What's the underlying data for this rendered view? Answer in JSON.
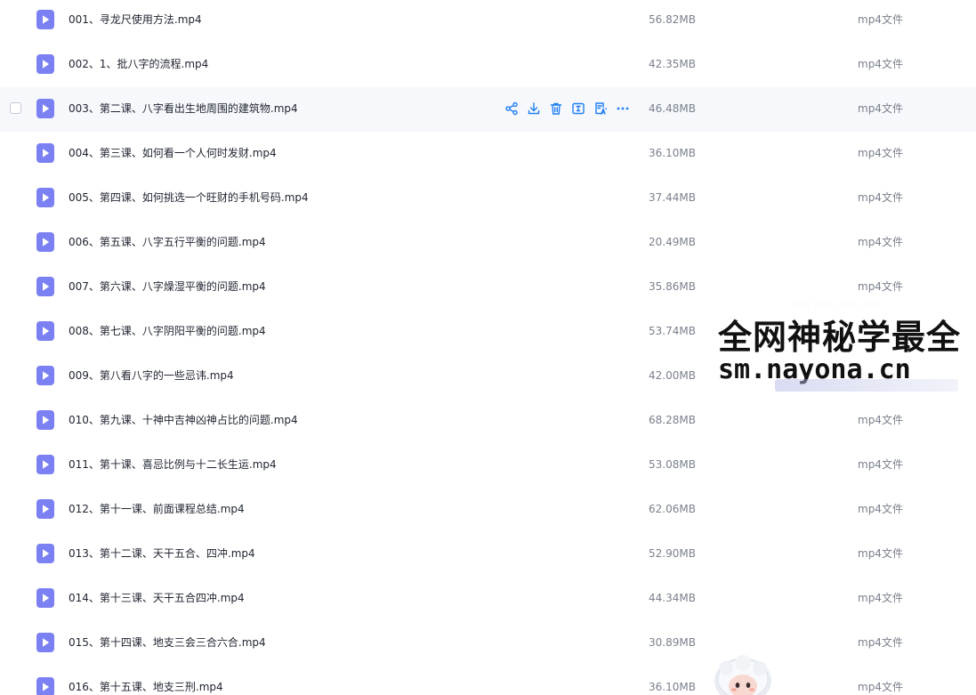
{
  "files": [
    {
      "name": "001、寻龙尺使用方法.mp4",
      "size": "56.82MB",
      "type": "mp4文件"
    },
    {
      "name": "002、1、批八字的流程.mp4",
      "size": "42.35MB",
      "type": "mp4文件"
    },
    {
      "name": "003、第二课、八字看出生地周围的建筑物.mp4",
      "size": "46.48MB",
      "type": "mp4文件"
    },
    {
      "name": "004、第三课、如何看一个人何时发财.mp4",
      "size": "36.10MB",
      "type": "mp4文件"
    },
    {
      "name": "005、第四课、如何挑选一个旺财的手机号码.mp4",
      "size": "37.44MB",
      "type": "mp4文件"
    },
    {
      "name": "006、第五课、八字五行平衡的问题.mp4",
      "size": "20.49MB",
      "type": "mp4文件"
    },
    {
      "name": "007、第六课、八字燥湿平衡的问题.mp4",
      "size": "35.86MB",
      "type": "mp4文件"
    },
    {
      "name": "008、第七课、八字阴阳平衡的问题.mp4",
      "size": "53.74MB",
      "type": "mp4文件"
    },
    {
      "name": "009、第八看八字的一些忌讳.mp4",
      "size": "42.00MB",
      "type": "mp4文件"
    },
    {
      "name": "010、第九课、十神中吉神凶神占比的问题.mp4",
      "size": "68.28MB",
      "type": "mp4文件"
    },
    {
      "name": "011、第十课、喜忌比例与十二长生运.mp4",
      "size": "53.08MB",
      "type": "mp4文件"
    },
    {
      "name": "012、第十一课、前面课程总结.mp4",
      "size": "62.06MB",
      "type": "mp4文件"
    },
    {
      "name": "013、第十二课、天干五合、四冲.mp4",
      "size": "52.90MB",
      "type": "mp4文件"
    },
    {
      "name": "014、第十三课、天干五合四冲.mp4",
      "size": "44.34MB",
      "type": "mp4文件"
    },
    {
      "name": "015、第十四课、地支三会三合六合.mp4",
      "size": "30.89MB",
      "type": "mp4文件"
    },
    {
      "name": "016、第十五课、地支三刑.mp4",
      "size": "36.10MB",
      "type": "mp4文件"
    }
  ],
  "hovered_row": 2,
  "row_actions": [
    "share-icon",
    "download-icon",
    "delete-icon",
    "rename-icon",
    "ai-summary-icon",
    "more-icon"
  ],
  "colors": {
    "video_icon": "#7b80f2",
    "action_icon": "#1f7ef5",
    "hover_row_bg": "#f6f8fc"
  },
  "watermark": {
    "line1": "全网神秘学最全",
    "line2": "sm.nayona.cn"
  }
}
